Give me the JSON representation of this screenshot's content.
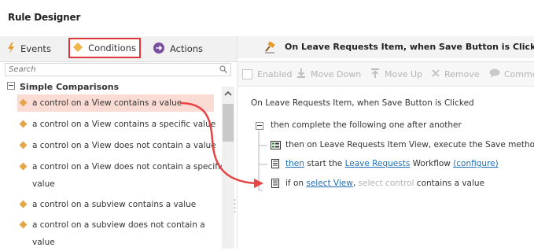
{
  "app": {
    "title": "Rule Designer"
  },
  "tabs": [
    {
      "label": "Events",
      "icon": "lightning-icon"
    },
    {
      "label": "Conditions",
      "icon": "diamond-icon",
      "selected": true
    },
    {
      "label": "Actions",
      "icon": "arrow-circle-icon"
    }
  ],
  "search": {
    "placeholder": "Search"
  },
  "tree": {
    "group_label": "Simple Comparisons",
    "items": [
      {
        "lines": [
          "a control on a View contains a value"
        ],
        "selected": true
      },
      {
        "lines": [
          "a control on a View contains a specific value"
        ]
      },
      {
        "lines": [
          "a control on a View does not contain a value"
        ]
      },
      {
        "lines": [
          "a control on a View does not contain a specific",
          "value"
        ]
      },
      {
        "lines": [
          "a control on a subview contains a value"
        ]
      },
      {
        "lines": [
          "a control on a subview does not contain a",
          "value"
        ]
      }
    ]
  },
  "rule": {
    "header_title": "On Leave Requests Item, when Save Button is Clicked",
    "toolbar": {
      "enabled": "Enabled",
      "move_down": "Move Down",
      "move_up": "Move Up",
      "remove": "Remove",
      "comment": "Comme"
    },
    "event_line": {
      "prefix": "On ",
      "item": "Leave Requests Item",
      "middle": ", when ",
      "control": "Save Button",
      "suffix": " is Clicked"
    },
    "group_line": "then complete the following one after another",
    "action1": {
      "prefix": "then on ",
      "view": "Leave Requests Item View",
      "middle": ", execute the ",
      "method": "Save",
      "suffix": " method"
    },
    "action2": {
      "then": "then",
      "middle": " start the ",
      "workflow": "Leave Requests",
      "suffix": " Workflow ",
      "configure": "(configure)"
    },
    "condition": {
      "prefix": "if on ",
      "view": "select View",
      "comma": ", ",
      "control": "select control",
      "suffix": " contains a value"
    }
  },
  "colors": {
    "highlight_red": "#d9373a",
    "link_blue": "#1f6fb8",
    "diamond_orange": "#e5a64a",
    "selected_row": "#fbdcd4"
  }
}
